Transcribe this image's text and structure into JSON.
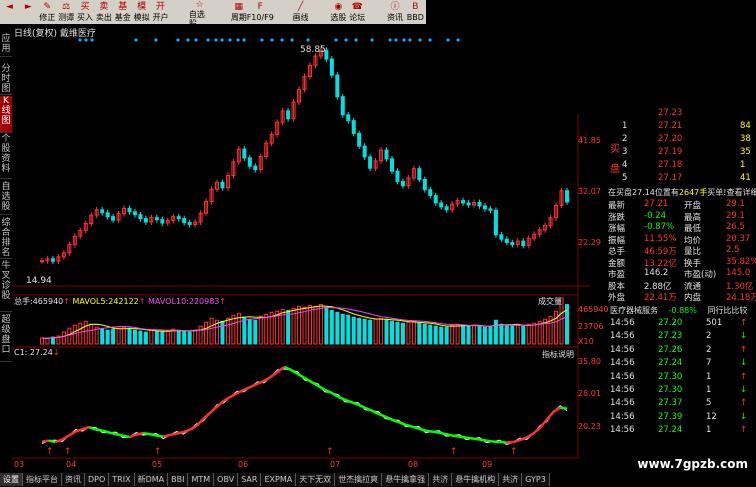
{
  "toolbar": {
    "buttons": [
      "",
      "",
      "修正",
      "测谭",
      "买入",
      "卖出",
      "基金",
      "模拟",
      "开户",
      "",
      "自选股",
      "",
      "周期",
      "F10/F9",
      "",
      "画线",
      "",
      "选股",
      "论坛",
      "",
      "资讯",
      "BBD"
    ]
  },
  "sidebar": {
    "items": [
      "应用",
      "分时图",
      "K线图",
      "个股资料",
      "自选股",
      "综合排名",
      "牛叉诊股",
      "超级盘口"
    ]
  },
  "chart_header": {
    "period": "日线(复权)",
    "stock": "戴维医疗",
    "high_label": "58.85",
    "low_label": "14.94"
  },
  "price_axis": {
    "labels": [
      "41.85",
      "32.07",
      "22.29"
    ]
  },
  "volume_header": {
    "total_label": "总手:",
    "total_value": "465940",
    "ma5_label": "MAVOL5:",
    "ma5_value": "242122",
    "ma10_label": "MAVOL10:",
    "ma10_value": "220983",
    "button": "成交量"
  },
  "volume_axis": {
    "labels": [
      "465940",
      "23706",
      "X10"
    ]
  },
  "indicator_header": {
    "label": "C1: 27.24",
    "button": "指标说明"
  },
  "indicator_axis": {
    "labels": [
      "35.80",
      "28.01",
      "20.23"
    ]
  },
  "x_axis": {
    "labels": [
      "03",
      "04",
      "05",
      "06",
      "07",
      "08",
      "09"
    ]
  },
  "bottom_tabs": [
    "设置",
    "指标平台",
    "资讯",
    "DPO",
    "TRIX",
    "新DMA",
    "BBI",
    "MTM",
    "OBV",
    "SAR",
    "EXPMA",
    "天下无双",
    "世杰擒拉爽",
    "悬牛擒拿强",
    "共济",
    "悬牛擒机构",
    "共济",
    "GYP3"
  ],
  "orderbook": {
    "sell": [
      {
        "n": "",
        "price": "27.23",
        "vol": ""
      },
      {
        "n": "1",
        "price": "27.21",
        "vol": "84"
      },
      {
        "n": "2",
        "price": "27.20",
        "vol": "38"
      },
      {
        "n": "3",
        "price": "27.19",
        "vol": "35"
      },
      {
        "n": "4",
        "price": "27.18",
        "vol": "1"
      },
      {
        "n": "5",
        "price": "27.17",
        "vol": "41"
      }
    ],
    "buy_label_1": "买",
    "buy_label_2": "盘",
    "inbuy_text": "在买盘27.14位置有",
    "inbuy_vol": "2647手",
    "inbuy_action": "买单!查看详细"
  },
  "quote": [
    {
      "l1": "最新",
      "v1": "27.21",
      "l2": "开盘",
      "v2": "29.1"
    },
    {
      "l1": "涨跌",
      "v1": "-0.24",
      "l2": "最高",
      "v2": "29.1"
    },
    {
      "l1": "涨幅",
      "v1": "-0.87%",
      "l2": "最低",
      "v2": "26.5"
    },
    {
      "l1": "振幅",
      "v1": "11.55%",
      "l2": "均价",
      "v2": "20.37"
    },
    {
      "l1": "总手",
      "v1": "46.59万",
      "l2": "量比",
      "v2": "2.5"
    },
    {
      "l1": "金额",
      "v1": "13.22亿",
      "l2": "换手",
      "v2": "35.82%"
    },
    {
      "l1": "市盈",
      "v1": "146.2",
      "l2": "市盈(动)",
      "v2": "145.0"
    },
    {
      "l1": "股本",
      "v1": "2.88亿",
      "l2": "流通",
      "v2": "1.30亿"
    },
    {
      "l1": "外盘",
      "v1": "22.41万",
      "l2": "内盘",
      "v2": "24.18万"
    }
  ],
  "industry": {
    "name": "医疗器械服务",
    "change": "-0.88%",
    "link": "同行比比较"
  },
  "ticks": [
    {
      "t": "14:56",
      "p": "27.20",
      "v": "501"
    },
    {
      "t": "14:56",
      "p": "27.23",
      "v": "2"
    },
    {
      "t": "14:56",
      "p": "27.26",
      "v": "2"
    },
    {
      "t": "14:56",
      "p": "27.24",
      "v": "7"
    },
    {
      "t": "14:56",
      "p": "27.30",
      "v": "1"
    },
    {
      "t": "14:56",
      "p": "27.30",
      "v": "1"
    },
    {
      "t": "14:56",
      "p": "27.37",
      "v": "5"
    },
    {
      "t": "14:56",
      "p": "27.39",
      "v": "12"
    },
    {
      "t": "14:56",
      "p": "27.24",
      "v": "1"
    }
  ],
  "watermark": "www.7gpzb.com",
  "colors": {
    "up": "#ff3030",
    "down": "#00e0e0",
    "ma5": "#ffffff",
    "ma10": "#ffff00",
    "ind_up": "#ff3030",
    "ind_down": "#00ff00"
  },
  "chart_data": {
    "type": "candlestick",
    "title": "戴维医疗 日线(复权)",
    "x_labels": [
      "03",
      "04",
      "05",
      "06",
      "07",
      "08",
      "09"
    ],
    "ylim": [
      14.94,
      58.85
    ],
    "close": [
      15.2,
      15.6,
      15.1,
      16.0,
      16.8,
      18.5,
      20.2,
      21.4,
      22.8,
      24.5,
      25.6,
      25.0,
      24.2,
      23.5,
      24.8,
      25.9,
      25.2,
      24.6,
      23.8,
      23.1,
      24.0,
      23.6,
      22.9,
      23.4,
      24.2,
      23.8,
      23.0,
      22.6,
      23.1,
      24.9,
      27.3,
      29.8,
      31.2,
      30.1,
      32.6,
      35.4,
      38.0,
      36.2,
      34.5,
      33.8,
      36.5,
      39.2,
      41.0,
      43.5,
      45.8,
      44.2,
      47.6,
      50.2,
      52.8,
      55.1,
      57.0,
      58.2,
      56.4,
      53.1,
      48.7,
      45.0,
      43.8,
      41.2,
      38.6,
      36.4,
      34.1,
      35.6,
      37.8,
      36.0,
      33.5,
      31.4,
      30.5,
      32.1,
      34.0,
      31.8,
      29.7,
      28.5,
      27.0,
      26.2,
      25.6,
      26.8,
      27.5,
      27.0,
      26.6,
      27.1,
      26.4,
      25.8,
      25.5,
      20.5,
      19.6,
      18.9,
      18.5,
      19.2,
      18.3,
      19.8,
      20.6,
      21.5,
      22.4,
      24.0,
      26.5,
      29.5,
      27.2
    ],
    "volume": [
      60,
      55,
      70,
      80,
      120,
      160,
      190,
      210,
      230,
      200,
      170,
      150,
      140,
      150,
      160,
      170,
      160,
      140,
      130,
      120,
      140,
      130,
      120,
      130,
      150,
      140,
      130,
      120,
      140,
      180,
      220,
      260,
      240,
      230,
      260,
      290,
      310,
      270,
      250,
      240,
      280,
      300,
      320,
      330,
      350,
      340,
      360,
      380,
      370,
      390,
      380,
      400,
      370,
      340,
      320,
      300,
      290,
      270,
      260,
      250,
      240,
      250,
      260,
      250,
      230,
      220,
      210,
      220,
      230,
      210,
      200,
      190,
      180,
      170,
      170,
      190,
      200,
      190,
      180,
      190,
      180,
      170,
      170,
      240,
      200,
      190,
      180,
      190,
      180,
      200,
      210,
      230,
      250,
      280,
      330,
      465,
      400
    ],
    "indicator": [
      20.6,
      20.8,
      20.5,
      21.0,
      21.8,
      22.6,
      23.1,
      23.5,
      23.0,
      22.8,
      22.4,
      22.1,
      21.8,
      21.5,
      22.0,
      22.3,
      22.1,
      21.8,
      21.6,
      21.9,
      22.2,
      22.5,
      23.0,
      23.8,
      25.2,
      26.4,
      27.6,
      28.8,
      29.6,
      30.3,
      31.0,
      31.6,
      32.2,
      32.8,
      33.6,
      34.6,
      35.6,
      35.0,
      34.2,
      33.4,
      32.6,
      31.8,
      31.0,
      30.4,
      29.6,
      29.0,
      28.5,
      28.0,
      27.4,
      26.8,
      26.2,
      25.6,
      25.0,
      24.5,
      24.0,
      23.6,
      23.2,
      22.8,
      22.6,
      22.4,
      22.1,
      21.8,
      21.6,
      21.4,
      21.2,
      21.0,
      20.8,
      20.6,
      20.5,
      20.4,
      20.5,
      20.9,
      21.4,
      22.2,
      23.4,
      25.0,
      26.6,
      27.4,
      27.2
    ]
  }
}
